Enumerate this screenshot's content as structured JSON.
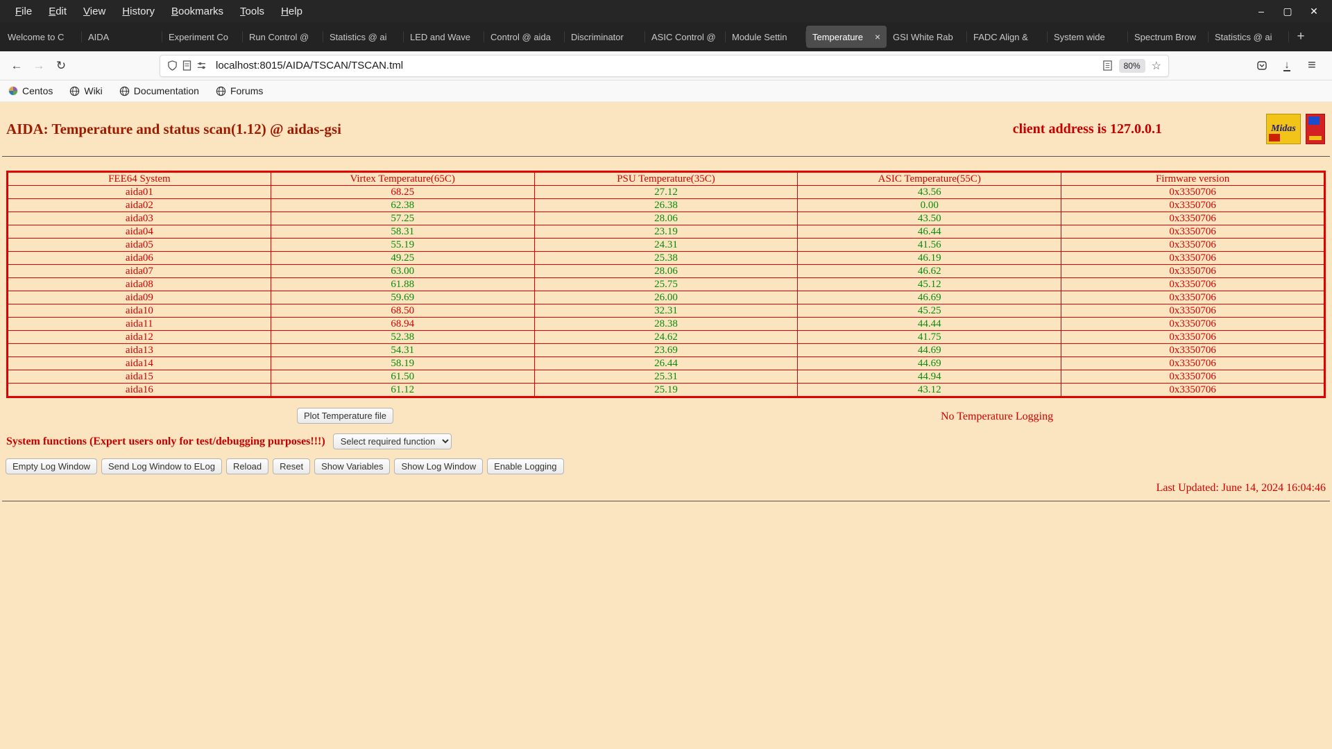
{
  "window": {
    "menu": [
      "File",
      "Edit",
      "View",
      "History",
      "Bookmarks",
      "Tools",
      "Help"
    ]
  },
  "tabs": [
    {
      "label": "Welcome to C",
      "active": false
    },
    {
      "label": "AIDA",
      "active": false
    },
    {
      "label": "Experiment Co",
      "active": false
    },
    {
      "label": "Run Control @",
      "active": false
    },
    {
      "label": "Statistics @ ai",
      "active": false
    },
    {
      "label": "LED and Wave",
      "active": false
    },
    {
      "label": "Control @ aida",
      "active": false
    },
    {
      "label": "Discriminator",
      "active": false
    },
    {
      "label": "ASIC Control @",
      "active": false
    },
    {
      "label": "Module Settin",
      "active": false
    },
    {
      "label": "Temperature",
      "active": true
    },
    {
      "label": "GSI White Rab",
      "active": false
    },
    {
      "label": "FADC Align &",
      "active": false
    },
    {
      "label": "System wide",
      "active": false
    },
    {
      "label": "Spectrum Brow",
      "active": false
    },
    {
      "label": "Statistics @ ai",
      "active": false
    }
  ],
  "nav": {
    "url": "localhost:8015/AIDA/TSCAN/TSCAN.tml",
    "zoom": "80%"
  },
  "bookmarks": [
    "Centos",
    "Wiki",
    "Documentation",
    "Forums"
  ],
  "page": {
    "title": "AIDA: Temperature and status scan(1.12) @ aidas-gsi",
    "client_address": "client address is 127.0.0.1",
    "logos": {
      "midas_label": "Midas"
    },
    "table": {
      "headers": [
        "FEE64 System",
        "Virtex Temperature(65C)",
        "PSU Temperature(35C)",
        "ASIC Temperature(55C)",
        "Firmware version"
      ],
      "rows": [
        {
          "name": "aida01",
          "virtex": "68.25",
          "psu": "27.12",
          "asic": "43.56",
          "fw": "0x3350706",
          "virtex_alarm": true,
          "psu_alarm": false,
          "asic_alarm": false
        },
        {
          "name": "aida02",
          "virtex": "62.38",
          "psu": "26.38",
          "asic": "0.00",
          "fw": "0x3350706",
          "virtex_alarm": false,
          "psu_alarm": false,
          "asic_alarm": false
        },
        {
          "name": "aida03",
          "virtex": "57.25",
          "psu": "28.06",
          "asic": "43.50",
          "fw": "0x3350706",
          "virtex_alarm": false,
          "psu_alarm": false,
          "asic_alarm": false
        },
        {
          "name": "aida04",
          "virtex": "58.31",
          "psu": "23.19",
          "asic": "46.44",
          "fw": "0x3350706",
          "virtex_alarm": false,
          "psu_alarm": false,
          "asic_alarm": false
        },
        {
          "name": "aida05",
          "virtex": "55.19",
          "psu": "24.31",
          "asic": "41.56",
          "fw": "0x3350706",
          "virtex_alarm": false,
          "psu_alarm": false,
          "asic_alarm": false
        },
        {
          "name": "aida06",
          "virtex": "49.25",
          "psu": "25.38",
          "asic": "46.19",
          "fw": "0x3350706",
          "virtex_alarm": false,
          "psu_alarm": false,
          "asic_alarm": false
        },
        {
          "name": "aida07",
          "virtex": "63.00",
          "psu": "28.06",
          "asic": "46.62",
          "fw": "0x3350706",
          "virtex_alarm": false,
          "psu_alarm": false,
          "asic_alarm": false
        },
        {
          "name": "aida08",
          "virtex": "61.88",
          "psu": "25.75",
          "asic": "45.12",
          "fw": "0x3350706",
          "virtex_alarm": false,
          "psu_alarm": false,
          "asic_alarm": false
        },
        {
          "name": "aida09",
          "virtex": "59.69",
          "psu": "26.00",
          "asic": "46.69",
          "fw": "0x3350706",
          "virtex_alarm": false,
          "psu_alarm": false,
          "asic_alarm": false
        },
        {
          "name": "aida10",
          "virtex": "68.50",
          "psu": "32.31",
          "asic": "45.25",
          "fw": "0x3350706",
          "virtex_alarm": true,
          "psu_alarm": false,
          "asic_alarm": false
        },
        {
          "name": "aida11",
          "virtex": "68.94",
          "psu": "28.38",
          "asic": "44.44",
          "fw": "0x3350706",
          "virtex_alarm": true,
          "psu_alarm": false,
          "asic_alarm": false
        },
        {
          "name": "aida12",
          "virtex": "52.38",
          "psu": "24.62",
          "asic": "41.75",
          "fw": "0x3350706",
          "virtex_alarm": false,
          "psu_alarm": false,
          "asic_alarm": false
        },
        {
          "name": "aida13",
          "virtex": "54.31",
          "psu": "23.69",
          "asic": "44.69",
          "fw": "0x3350706",
          "virtex_alarm": false,
          "psu_alarm": false,
          "asic_alarm": false
        },
        {
          "name": "aida14",
          "virtex": "58.19",
          "psu": "26.44",
          "asic": "44.69",
          "fw": "0x3350706",
          "virtex_alarm": false,
          "psu_alarm": false,
          "asic_alarm": false
        },
        {
          "name": "aida15",
          "virtex": "61.50",
          "psu": "25.31",
          "asic": "44.94",
          "fw": "0x3350706",
          "virtex_alarm": false,
          "psu_alarm": false,
          "asic_alarm": false
        },
        {
          "name": "aida16",
          "virtex": "61.12",
          "psu": "25.19",
          "asic": "43.12",
          "fw": "0x3350706",
          "virtex_alarm": false,
          "psu_alarm": false,
          "asic_alarm": false
        }
      ]
    },
    "plot_button_label": "Plot Temperature file",
    "logging_status": "No Temperature Logging",
    "system_functions_label": "System functions (Expert users only for test/debugging purposes!!!)",
    "select_placeholder": "Select required function",
    "footer_buttons": [
      "Empty Log Window",
      "Send Log Window to ELog",
      "Reload",
      "Reset",
      "Show Variables",
      "Show Log Window",
      "Enable Logging"
    ],
    "last_updated": "Last Updated: June 14, 2024 16:04:46"
  }
}
